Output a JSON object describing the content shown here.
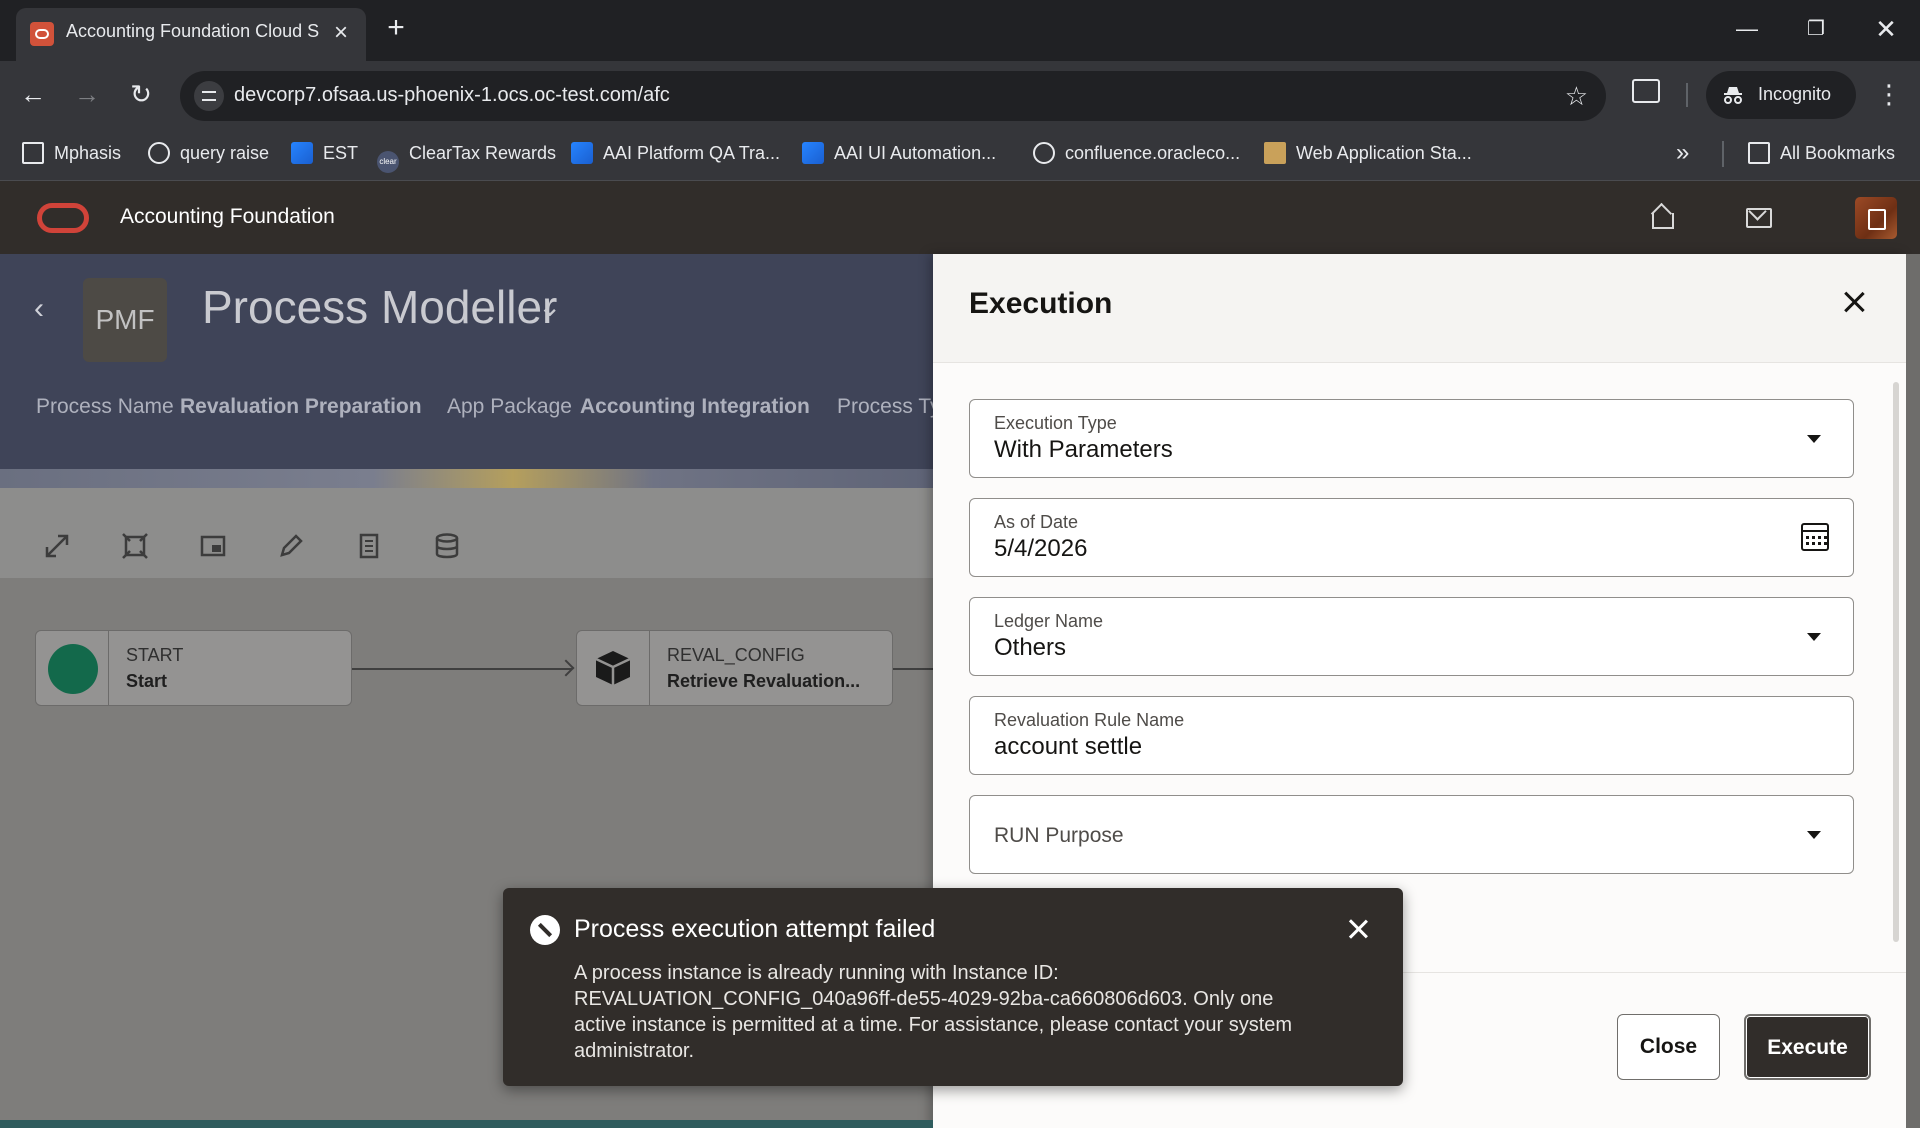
{
  "browser": {
    "tab_title": "Accounting Foundation Cloud S",
    "url": "devcorp7.ofsaa.us-phoenix-1.ocs.oc-test.com/afc",
    "incognito_label": "Incognito",
    "bookmarks": [
      {
        "label": "Mphasis",
        "icon": "folder-icon"
      },
      {
        "label": "query raise",
        "icon": "globe-icon"
      },
      {
        "label": "EST",
        "icon": "confluence-icon"
      },
      {
        "label": "ClearTax Rewards",
        "icon": "cleartax-icon"
      },
      {
        "label": "AAI Platform QA Tra...",
        "icon": "confluence-icon"
      },
      {
        "label": "AAI UI Automation...",
        "icon": "confluence-icon"
      },
      {
        "label": "confluence.oracleco...",
        "icon": "globe-icon"
      },
      {
        "label": "Web Application Sta...",
        "icon": "web-app-icon"
      }
    ],
    "all_bookmarks": "All Bookmarks"
  },
  "app": {
    "title": "Accounting Foundation"
  },
  "process": {
    "badge": "PMF",
    "title": "Process Modeller",
    "meta": [
      {
        "label": "Process Name",
        "value": "Revaluation Preparation"
      },
      {
        "label": "App Package",
        "value": "Accounting Integration"
      },
      {
        "label": "Process Ty",
        "value": ""
      }
    ],
    "nodes": [
      {
        "id": "START",
        "name": "Start",
        "kind": "start"
      },
      {
        "id": "REVAL_CONFIG",
        "name": "Retrieve Revaluation...",
        "kind": "task"
      }
    ]
  },
  "drawer": {
    "title": "Execution",
    "fields": {
      "execution_type": {
        "label": "Execution Type",
        "value": "With Parameters"
      },
      "as_of_date": {
        "label": "As of Date",
        "value": "5/4/2026"
      },
      "ledger_name": {
        "label": "Ledger Name",
        "value": "Others"
      },
      "rule_name": {
        "label": "Revaluation Rule Name",
        "value": "account settle"
      },
      "run_purpose": {
        "label": "RUN Purpose"
      }
    },
    "close_label": "Close",
    "execute_label": "Execute"
  },
  "toast": {
    "title": "Process execution attempt failed",
    "body": "A process instance is already running with Instance ID: REVALUATION_CONFIG_040a96ff-de55-4029-92ba-ca660806d603. Only one active instance is permitted at a time. For assistance, please contact your system administrator."
  },
  "colors": {
    "oracle_red": "#d04339",
    "header_bg": "#312d2a",
    "banner_bg": "#3f4458",
    "start_node": "#13694b"
  }
}
